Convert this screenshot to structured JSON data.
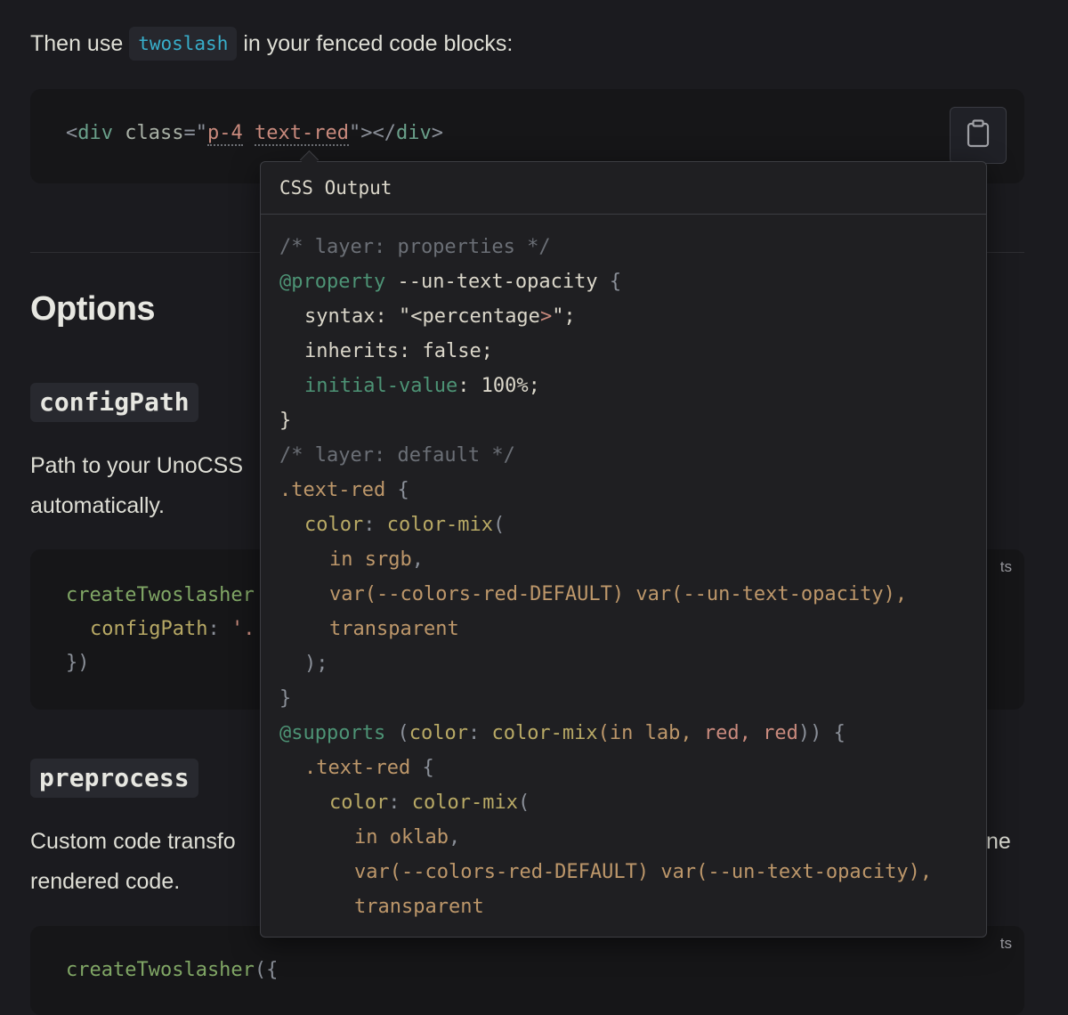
{
  "intro": {
    "before": "Then use",
    "code": "twoslash",
    "after": "in your fenced code blocks:"
  },
  "example_block": {
    "punc_open": "<",
    "tag": "div",
    "attr": "class",
    "eq_quote": "=\"",
    "class1": "p-4",
    "space": " ",
    "class2": "text-red",
    "close_quote": "\"",
    "close": "></",
    "tag2": "div",
    "end": ">"
  },
  "copy_button": {
    "icon": "clipboard-icon"
  },
  "options_heading": "Options",
  "config_path": {
    "heading": "configPath",
    "desc_line1": "Path to your UnoCSS",
    "desc_line2": "automatically.",
    "lang": "ts",
    "fn": "createTwoslasher",
    "prop": "configPath",
    "colon": ":",
    "str": "'.",
    "close": "})"
  },
  "preprocess": {
    "heading": "preprocess",
    "desc_line1": "Custom code transfo",
    "desc_line1_tail": "ne",
    "desc_line2": "rendered code.",
    "lang": "ts",
    "fn": "createTwoslasher",
    "fn_punc": "({"
  },
  "popup": {
    "title": "CSS Output",
    "lines": {
      "l1": "/* layer: properties */",
      "l2_at": "@property",
      "l2_name": "--un-text-opacity",
      "l2_brace": "{",
      "l3_prop": "syntax",
      "l3_colon": ":",
      "l3_str_a": "\"<percentage",
      "l3_str_b": ">",
      "l3_str_c": "\";",
      "l4_prop": "inherits",
      "l4_rest": ": false;",
      "l5_prop": "initial-value",
      "l5_rest": ": 100%;",
      "l6": "}",
      "l7": "/* layer: default */",
      "l8_sel": ".text-red",
      "l8_brace": "{",
      "l9_prop": "color",
      "l9_colon": ":",
      "l9_fn": "color-mix",
      "l9_paren": "(",
      "l10_in": "in",
      "l10_space": "srgb",
      "l10_comma": ",",
      "l11_var1": "var",
      "l11_arg1": "(--colors-red-DEFAULT)",
      "l11_var2": "var",
      "l11_arg2": "(--un-text-opacity),",
      "l12": "transparent",
      "l13": ");",
      "l14": "}",
      "l15_at": "@supports",
      "l15_open": "(",
      "l15_prop": "color",
      "l15_colon": ":",
      "l15_fn": "color-mix",
      "l15_args_in": "(in",
      "l15_lab": "lab,",
      "l15_red1": "red,",
      "l15_red2": "red",
      "l15_close": "))",
      "l15_brace": "{",
      "l16_sel": ".text-red",
      "l16_brace": "{",
      "l17_prop": "color",
      "l17_colon": ":",
      "l17_fn": "color-mix",
      "l17_paren": "(",
      "l18_in": "in",
      "l18_space": "oklab",
      "l18_comma": ",",
      "l19_var1": "var",
      "l19_arg1": "(--colors-red-DEFAULT)",
      "l19_var2": "var",
      "l19_arg2": "(--un-text-opacity),",
      "l20": "transparent"
    }
  }
}
